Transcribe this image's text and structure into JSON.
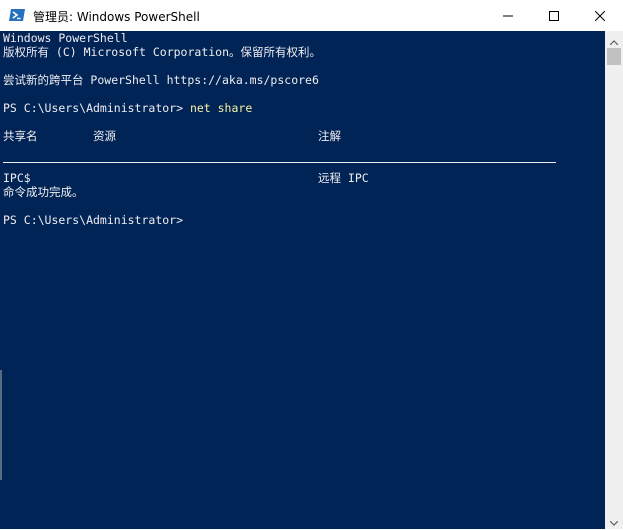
{
  "window": {
    "title": "管理员: Windows PowerShell",
    "icon": "powershell-icon",
    "controls": {
      "minimize_icon": "minimize-icon",
      "maximize_icon": "maximize-icon",
      "close_icon": "close-icon"
    }
  },
  "console": {
    "banner_line1": "Windows PowerShell",
    "banner_line2": "版权所有 (C) Microsoft Corporation。保留所有权利。",
    "banner_line3": "尝试新的跨平台 PowerShell https://aka.ms/pscore6",
    "prompt1": "PS C:\\Users\\Administrator> ",
    "command1": "net share",
    "headers": {
      "share_name": "共享名",
      "resource": "资源",
      "remark": "注解"
    },
    "rows": [
      {
        "share_name": "IPC$",
        "resource": "",
        "remark": "远程 IPC"
      }
    ],
    "completion": "命令成功完成。",
    "prompt2": "PS C:\\Users\\Administrator>"
  },
  "colors": {
    "console_bg": "#012456",
    "console_fg": "#eeedf0",
    "command_fg": "#f9f1a5",
    "titlebar_bg": "#ffffff"
  }
}
